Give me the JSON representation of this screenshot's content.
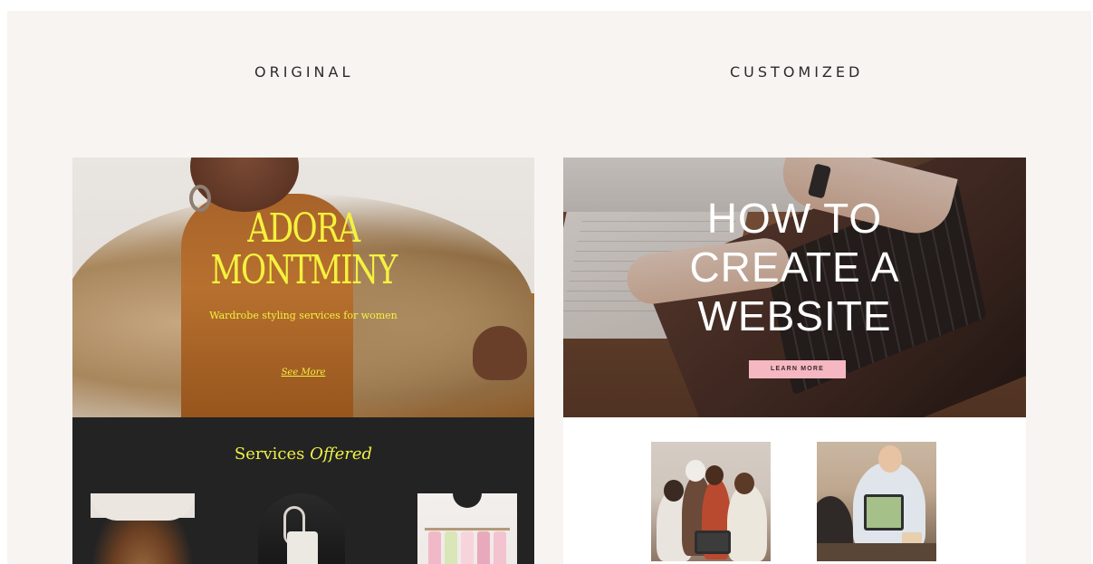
{
  "labels": {
    "original": "ORIGINAL",
    "customized": "CUSTOMIZED"
  },
  "original": {
    "title_line1": "ADORA",
    "title_line2": "MONTMINY",
    "subtitle": "Wardrobe styling services for women",
    "link": "See More",
    "services_title_plain": "Services ",
    "services_title_italic": "Offered"
  },
  "customized": {
    "title_line1": "HOW TO",
    "title_line2": "CREATE A",
    "title_line3": "WEBSITE",
    "button_label": "LEARN MORE"
  },
  "colors": {
    "page_bg": "#f8f4f1",
    "accent_yellow": "#f4f23f",
    "dark_section": "#232323",
    "button_pink": "#f5b7c2"
  }
}
